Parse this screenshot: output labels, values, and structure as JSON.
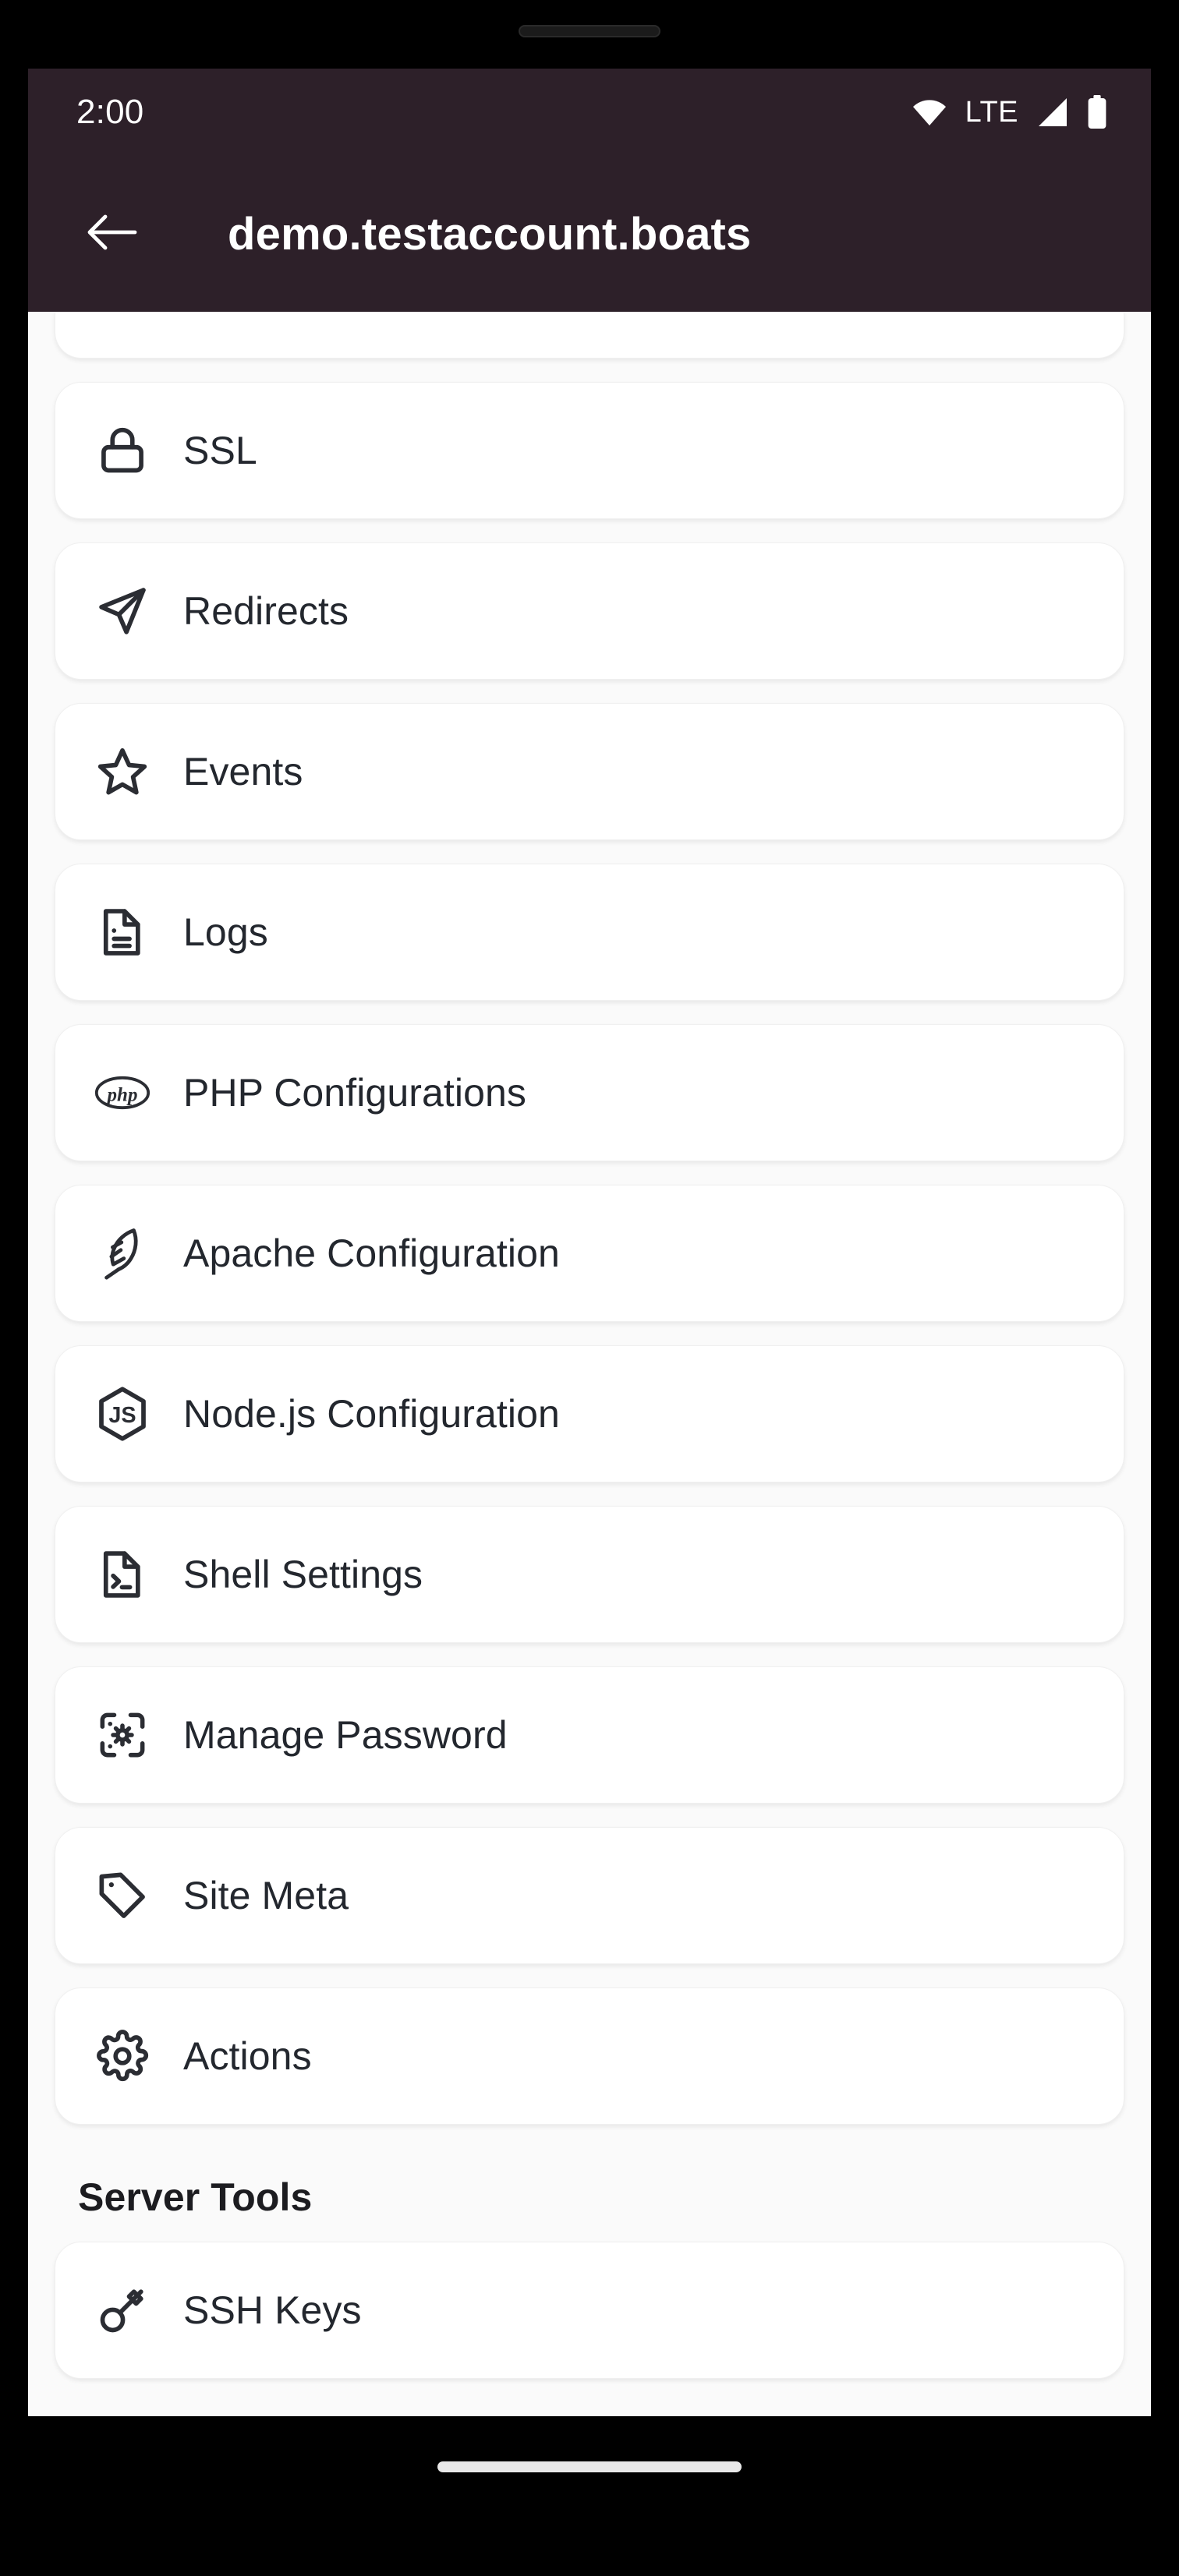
{
  "status_bar": {
    "time": "2:00",
    "network_label": "LTE",
    "icons": [
      "wifi-icon",
      "signal-icon",
      "battery-icon"
    ]
  },
  "app_bar": {
    "back_icon": "back-arrow-icon",
    "title": "demo.testaccount.boats"
  },
  "theme": {
    "app_bar_bg": "#2d2029",
    "page_bg": "#fafafa",
    "card_bg": "#ffffff",
    "text": "#23272e",
    "icon": "#2b2d33"
  },
  "menu": {
    "items": [
      {
        "label": "",
        "icon": "database-icon",
        "clipped": true
      },
      {
        "label": "SSL",
        "icon": "lock-icon",
        "clipped": false
      },
      {
        "label": "Redirects",
        "icon": "send-arrow-icon",
        "clipped": false
      },
      {
        "label": "Events",
        "icon": "star-icon",
        "clipped": false
      },
      {
        "label": "Logs",
        "icon": "document-lines-icon",
        "clipped": false
      },
      {
        "label": "PHP Configurations",
        "icon": "php-icon",
        "clipped": false
      },
      {
        "label": "Apache Configuration",
        "icon": "feather-icon",
        "clipped": false
      },
      {
        "label": "Node.js Configuration",
        "icon": "nodejs-icon",
        "clipped": false
      },
      {
        "label": "Shell Settings",
        "icon": "terminal-file-icon",
        "clipped": false
      },
      {
        "label": "Manage Password",
        "icon": "server-gear-icon",
        "clipped": false
      },
      {
        "label": "Site Meta",
        "icon": "tag-icon",
        "clipped": false
      },
      {
        "label": "Actions",
        "icon": "gear-icon",
        "clipped": false
      }
    ]
  },
  "server_tools": {
    "header": "Server Tools",
    "items": [
      {
        "label": "SSH Keys",
        "icon": "key-icon"
      }
    ]
  },
  "gesture_nav": {
    "handle": "home-gesture-pill"
  }
}
